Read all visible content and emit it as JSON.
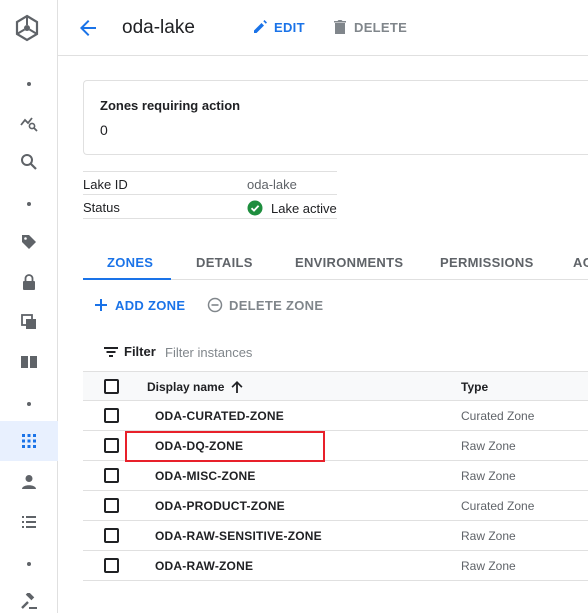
{
  "header": {
    "title": "oda-lake",
    "edit_label": "EDIT",
    "delete_label": "DELETE"
  },
  "summary_card": {
    "title": "Zones requiring action",
    "value": "0"
  },
  "info": {
    "lake_id_label": "Lake ID",
    "lake_id_value": "oda-lake",
    "status_label": "Status",
    "status_value": "Lake active"
  },
  "tabs": [
    {
      "label": "ZONES",
      "active": true
    },
    {
      "label": "DETAILS",
      "active": false
    },
    {
      "label": "ENVIRONMENTS",
      "active": false
    },
    {
      "label": "PERMISSIONS",
      "active": false
    },
    {
      "label": "AC",
      "active": false
    }
  ],
  "actions": {
    "add_zone_label": "ADD ZONE",
    "delete_zone_label": "DELETE ZONE"
  },
  "filter": {
    "label": "Filter",
    "placeholder": "Filter instances"
  },
  "table": {
    "columns": [
      "Display name",
      "Type"
    ],
    "rows": [
      {
        "name": "ODA-CURATED-ZONE",
        "type": "Curated Zone"
      },
      {
        "name": "ODA-DQ-ZONE",
        "type": "Raw Zone"
      },
      {
        "name": "ODA-MISC-ZONE",
        "type": "Raw Zone"
      },
      {
        "name": "ODA-PRODUCT-ZONE",
        "type": "Curated Zone"
      },
      {
        "name": "ODA-RAW-SENSITIVE-ZONE",
        "type": "Raw Zone"
      },
      {
        "name": "ODA-RAW-ZONE",
        "type": "Raw Zone"
      }
    ],
    "highlighted_row": "ODA-DQ-ZONE"
  },
  "colors": {
    "accent": "#1a73e8",
    "highlight": "#e8202a",
    "status_ok": "#1e8e3e"
  },
  "icons": {
    "rail": [
      "dataplex-logo",
      "dot",
      "chart-search-icon",
      "search-icon",
      "dot",
      "tag-icon",
      "lock-icon",
      "copy-icon",
      "book-icon",
      "dot",
      "grid-icon",
      "person-icon",
      "list-icon",
      "dot",
      "gavel-icon"
    ]
  }
}
